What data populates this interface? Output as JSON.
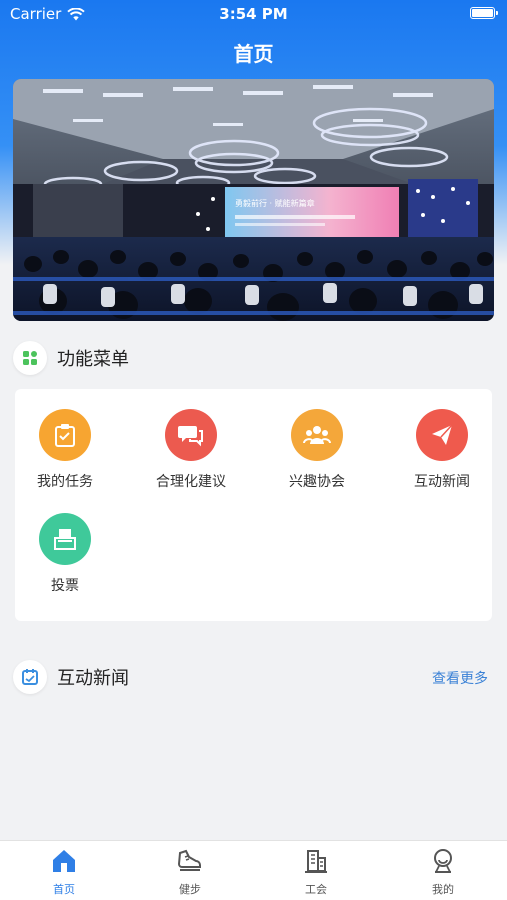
{
  "status_bar": {
    "carrier": "Carrier",
    "time": "3:54 PM"
  },
  "nav": {
    "title": "首页"
  },
  "banner": {
    "sign_text": "勇毅前行 · 赋能新篇章"
  },
  "menu_section": {
    "title": "功能菜单"
  },
  "menu": [
    {
      "label": "我的任务",
      "icon": "task-clipboard-icon",
      "color": "#f7a531"
    },
    {
      "label": "合理化建议",
      "icon": "chat-bubbles-icon",
      "color": "#ec5a4f"
    },
    {
      "label": "兴趣协会",
      "icon": "group-people-icon",
      "color": "#f4a73a"
    },
    {
      "label": "互动新闻",
      "icon": "paper-plane-icon",
      "color": "#ef5a4d"
    },
    {
      "label": "投票",
      "icon": "ballot-box-icon",
      "color": "#3fc99a"
    }
  ],
  "news_section": {
    "title": "互动新闻",
    "more": "查看更多"
  },
  "tabs": [
    {
      "label": "首页",
      "icon": "home-icon",
      "active": true
    },
    {
      "label": "健步",
      "icon": "shoe-icon",
      "active": false
    },
    {
      "label": "工会",
      "icon": "building-icon",
      "active": false
    },
    {
      "label": "我的",
      "icon": "profile-icon",
      "active": false
    }
  ],
  "colors": {
    "primary": "#1a78f0",
    "link": "#3b82d6",
    "tab_active": "#2f7fe6"
  }
}
